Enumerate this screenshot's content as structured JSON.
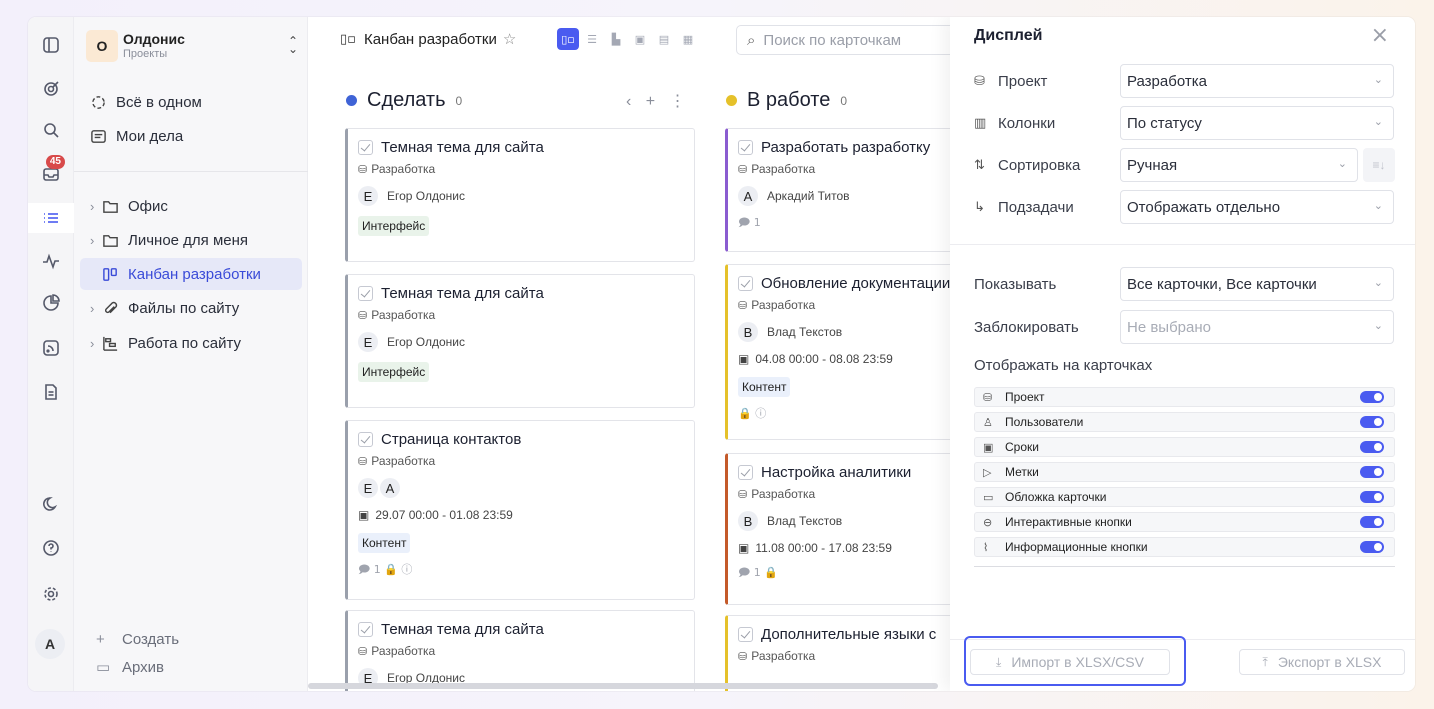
{
  "workspace": {
    "initial": "О",
    "name": "Олдонис",
    "subtitle": "Проекты"
  },
  "rail": {
    "notifications_badge": "45",
    "avatar_initial": "A"
  },
  "sidebar": {
    "top_items": [
      {
        "label": "Всё в одном"
      },
      {
        "label": "Мои дела"
      }
    ],
    "items": [
      {
        "label": "Офис"
      },
      {
        "label": "Личное для меня"
      },
      {
        "label": "Канбан разработки"
      },
      {
        "label": "Файлы по сайту"
      },
      {
        "label": "Работа по сайту"
      }
    ],
    "create_label": "Создать",
    "archive_label": "Архив"
  },
  "header": {
    "title": "Канбан разработки",
    "search_placeholder": "Поиск по карточкам"
  },
  "columns": [
    {
      "title": "Сделать",
      "count": "0",
      "color": "#3f63d6",
      "cards": [
        {
          "title": "Темная тема для сайта",
          "project": "Разработка",
          "user": "Егор Олдонис",
          "avatar": "E",
          "tag": "Интерфейс"
        },
        {
          "title": "Темная тема для сайта",
          "project": "Разработка",
          "user": "Егор Олдонис",
          "avatar": "E",
          "tag": "Интерфейс"
        },
        {
          "title": "Страница контактов",
          "project": "Разработка",
          "avatars": [
            "E",
            "A"
          ],
          "date": "29.07 00:00 - 01.08 23:59",
          "tag": "Контент",
          "meta": "🗩 1  🔒 ⓘ"
        },
        {
          "title": "Темная тема для сайта",
          "project": "Разработка",
          "user": "Егор Олдонис",
          "avatar": "E"
        }
      ]
    },
    {
      "title": "В работе",
      "count": "0",
      "color": "#e5c12a",
      "cards": [
        {
          "title": "Разработать разработку",
          "project": "Разработка",
          "user": "Аркадий Титов",
          "avatar": "A",
          "meta": "🗩 1"
        },
        {
          "title": "Обновление документации",
          "project": "Разработка",
          "user": "Влад Текстов",
          "avatar": "B",
          "date": "04.08 00:00 - 08.08 23:59",
          "tag": "Контент",
          "meta": "🔒 ⓘ"
        },
        {
          "title": "Настройка аналитики",
          "project": "Разработка",
          "user": "Влад Текстов",
          "avatar": "B",
          "date": "11.08 00:00 - 17.08 23:59",
          "meta": "🗩 1  🔒"
        },
        {
          "title": "Дополнительные языки с",
          "project": "Разработка"
        }
      ]
    }
  ],
  "display_panel": {
    "title": "Дисплей",
    "rows": [
      {
        "label": "Проект",
        "value": "Разработка"
      },
      {
        "label": "Колонки",
        "value": "По статусу"
      },
      {
        "label": "Сортировка",
        "value": "Ручная"
      },
      {
        "label": "Подзадачи",
        "value": "Отображать отдельно"
      }
    ],
    "show": {
      "label": "Показывать",
      "value": "Все карточки, Все карточки"
    },
    "lock": {
      "label": "Заблокировать",
      "placeholder": "Не выбрано"
    },
    "on_cards_label": "Отображать на карточках",
    "toggles": [
      {
        "label": "Проект",
        "on": true
      },
      {
        "label": "Пользователи",
        "on": true
      },
      {
        "label": "Сроки",
        "on": true
      },
      {
        "label": "Метки",
        "on": true
      },
      {
        "label": "Обложка карточки",
        "on": true
      },
      {
        "label": "Интерактивные кнопки",
        "on": true
      },
      {
        "label": "Информационные кнопки",
        "on": true
      }
    ],
    "import_label": "Импорт в XLSX/CSV",
    "export_label": "Экспорт в XLSX"
  },
  "colors": {
    "accent": "#4a5bf0",
    "badge": "#d84a4a",
    "red_card": "#c45a2a",
    "purple_card": "#8a5cd0"
  }
}
